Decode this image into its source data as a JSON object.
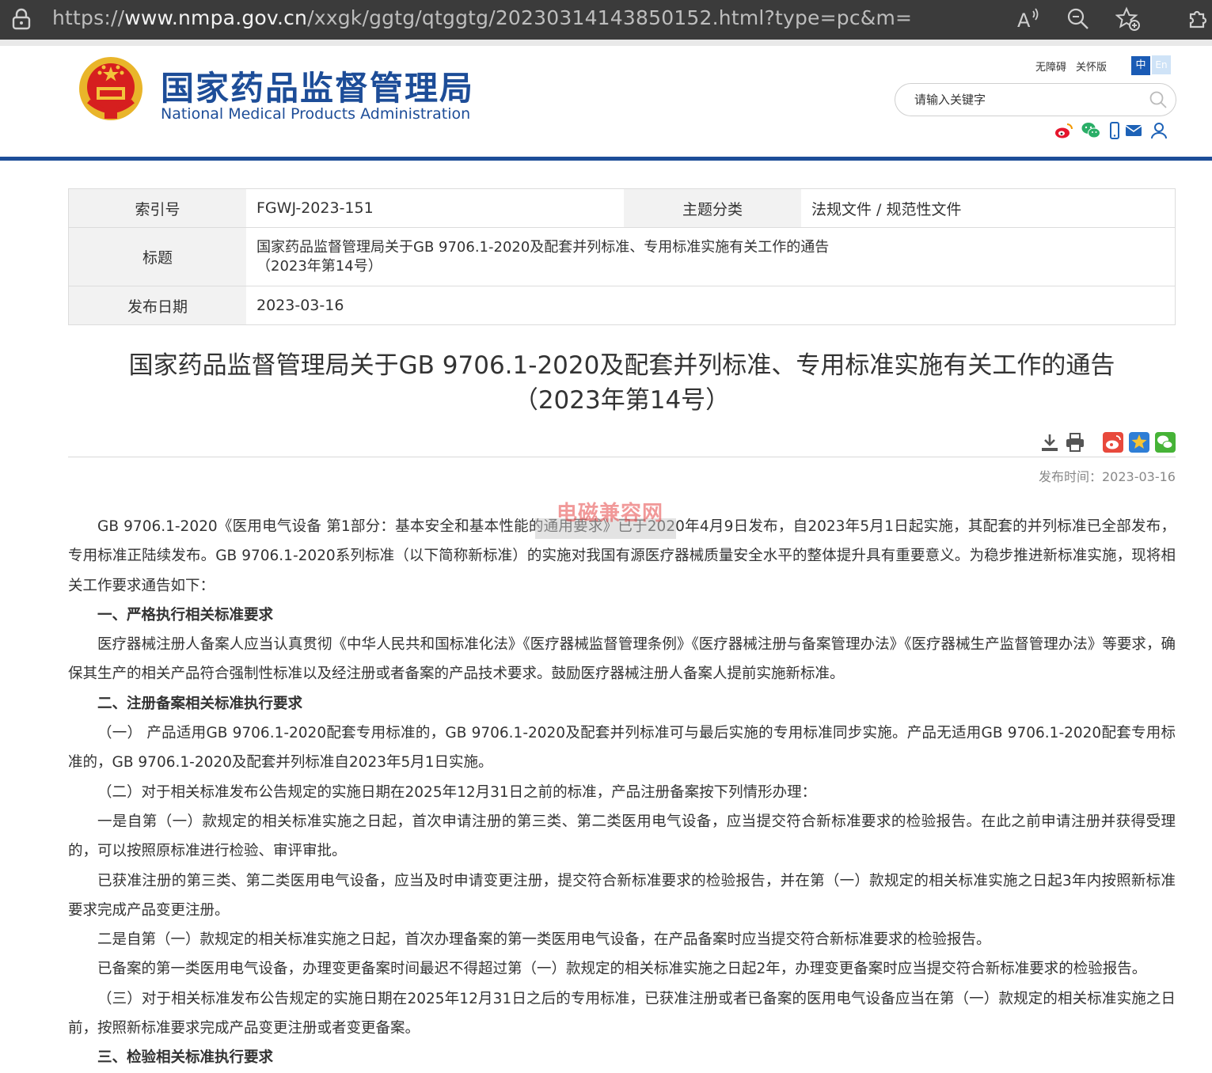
{
  "browser": {
    "url_prefix": "https://",
    "url_host": "www.nmpa.gov.cn",
    "url_path": "/xxgk/ggtg/qtggtg/20230314143850152.html?type=pc&m="
  },
  "site": {
    "name_cn": "国家药品监督管理局",
    "name_en": "National Medical Products Administration",
    "toplinks": [
      "无障碍",
      "关怀版"
    ],
    "lang_zh": "中",
    "lang_en": "En",
    "search_placeholder": "请输入关键字",
    "colors": {
      "brand_blue": "#1d4d98",
      "lang_active": "#1a5bb5"
    }
  },
  "info": {
    "index_label": "索引号",
    "index_value": "FGWJ-2023-151",
    "category_label": "主题分类",
    "category_value": "法规文件 / 规范性文件",
    "title_label": "标题",
    "title_line1": "国家药品监督管理局关于GB 9706.1-2020及配套并列标准、专用标准实施有关工作的通告",
    "title_line2": "（2023年第14号）",
    "date_label": "发布日期",
    "date_value": "2023-03-16"
  },
  "doc": {
    "title_line1": "国家药品监督管理局关于GB 9706.1-2020及配套并列标准、专用标准实施有关工作的通告",
    "title_line2": "（2023年第14号）",
    "pubtime": "发布时间：2023-03-16",
    "watermark": "电磁兼容网",
    "paragraphs": [
      {
        "heading": false,
        "text": "GB 9706.1-2020《医用电气设备 第1部分：基本安全和基本性能的通用要求》已于2020年4月9日发布，自2023年5月1日起实施，其配套的并列标准已全部发布，专用标准正陆续发布。GB 9706.1-2020系列标准（以下简称新标准）的实施对我国有源医疗器械质量安全水平的整体提升具有重要意义。为稳步推进新标准实施，现将相关工作要求通告如下："
      },
      {
        "heading": true,
        "text": "一、严格执行相关标准要求"
      },
      {
        "heading": false,
        "text": "医疗器械注册人备案人应当认真贯彻《中华人民共和国标准化法》《医疗器械监督管理条例》《医疗器械注册与备案管理办法》《医疗器械生产监督管理办法》等要求，确保其生产的相关产品符合强制性标准以及经注册或者备案的产品技术要求。鼓励医疗器械注册人备案人提前实施新标准。"
      },
      {
        "heading": true,
        "text": "二、注册备案相关标准执行要求"
      },
      {
        "heading": false,
        "text": "（一） 产品适用GB 9706.1-2020配套专用标准的，GB 9706.1-2020及配套并列标准可与最后实施的专用标准同步实施。产品无适用GB 9706.1-2020配套专用标准的，GB 9706.1-2020及配套并列标准自2023年5月1日实施。"
      },
      {
        "heading": false,
        "text": "（二）对于相关标准发布公告规定的实施日期在2025年12月31日之前的标准，产品注册备案按下列情形办理："
      },
      {
        "heading": false,
        "text": "一是自第（一）款规定的相关标准实施之日起，首次申请注册的第三类、第二类医用电气设备，应当提交符合新标准要求的检验报告。在此之前申请注册并获得受理的，可以按照原标准进行检验、审评审批。"
      },
      {
        "heading": false,
        "text": "已获准注册的第三类、第二类医用电气设备，应当及时申请变更注册，提交符合新标准要求的检验报告，并在第（一）款规定的相关标准实施之日起3年内按照新标准要求完成产品变更注册。"
      },
      {
        "heading": false,
        "text": "二是自第（一）款规定的相关标准实施之日起，首次办理备案的第一类医用电气设备，在产品备案时应当提交符合新标准要求的检验报告。"
      },
      {
        "heading": false,
        "text": "已备案的第一类医用电气设备，办理变更备案时间最迟不得超过第（一）款规定的相关标准实施之日起2年，办理变更备案时应当提交符合新标准要求的检验报告。"
      },
      {
        "heading": false,
        "text": "（三）对于相关标准发布公告规定的实施日期在2025年12月31日之后的专用标准，已获准注册或者已备案的医用电气设备应当在第（一）款规定的相关标准实施之日前，按照新标准要求完成产品变更注册或者变更备案。"
      },
      {
        "heading": true,
        "text": "三、检验相关标准执行要求"
      }
    ]
  }
}
